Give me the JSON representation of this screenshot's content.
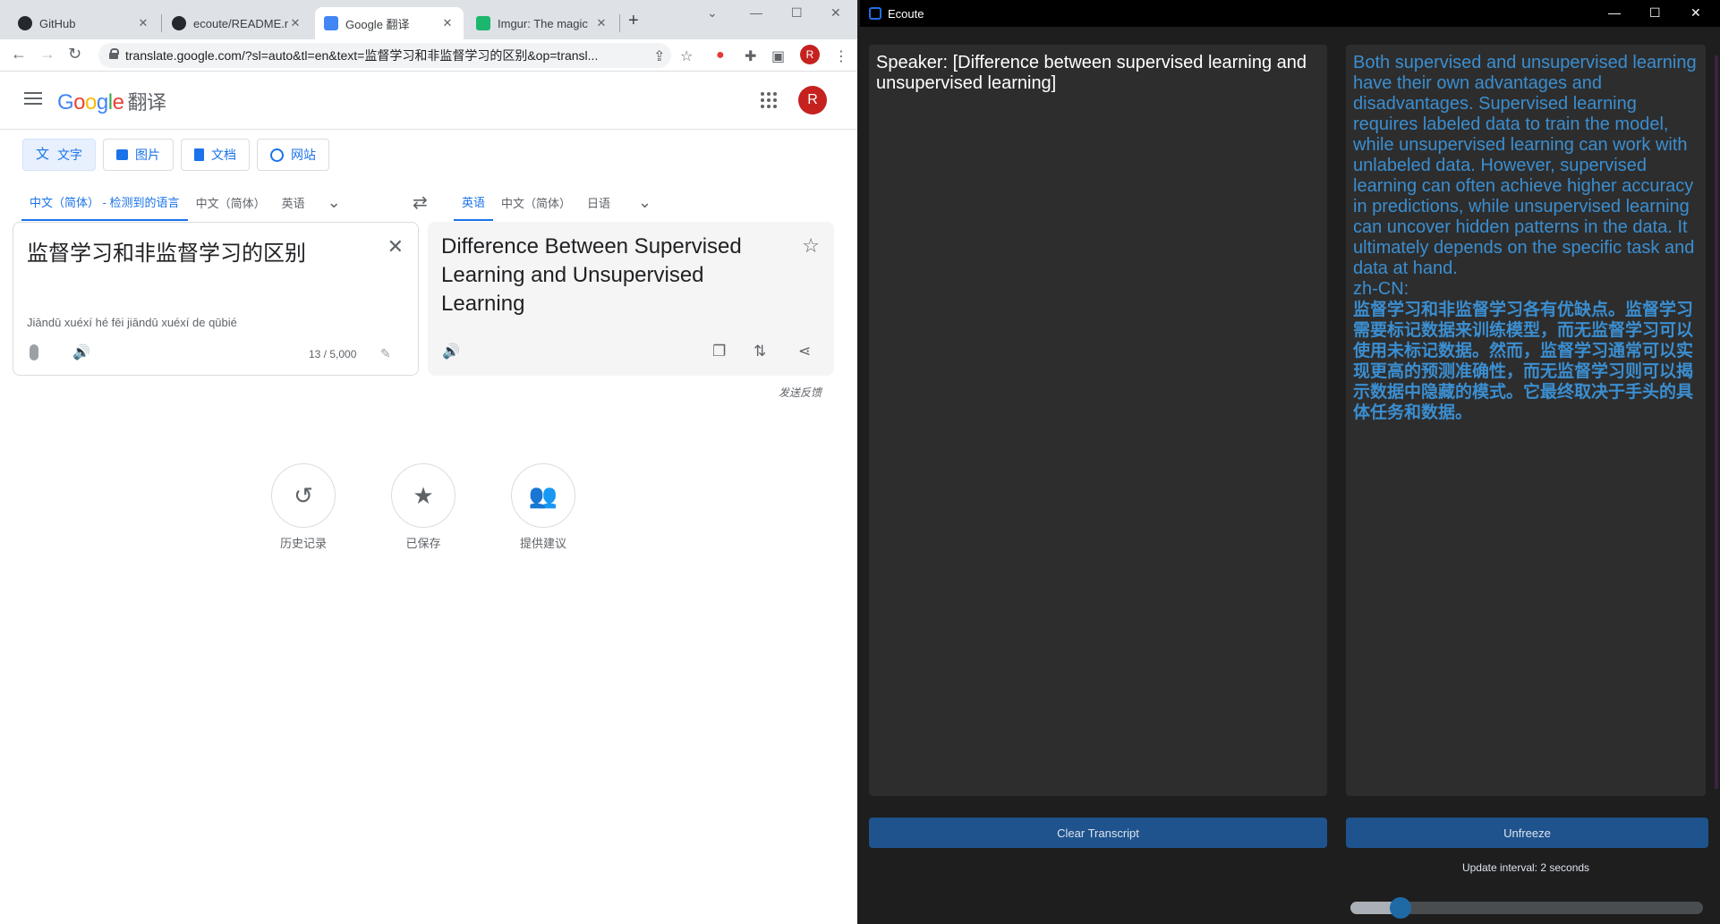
{
  "chrome": {
    "tabs": [
      {
        "title": "GitHub"
      },
      {
        "title": "ecoute/README.n"
      },
      {
        "title": "Google 翻译"
      },
      {
        "title": "Imgur: The magic"
      }
    ],
    "address": "translate.google.com/?sl=auto&tl=en&text=监督学习和非监督学习的区别&op=transl...",
    "profile_initial": "R"
  },
  "translate": {
    "logo_google": "Google",
    "logo_product": "翻译",
    "modes": [
      "文字",
      "图片",
      "文档",
      "网站"
    ],
    "source_langs": [
      "中文（简体） - 检测到的语言",
      "中文（简体）",
      "英语"
    ],
    "target_langs": [
      "英语",
      "中文（简体）",
      "日语"
    ],
    "source_text": "监督学习和非监督学习的区别",
    "pinyin": "Jiāndū xuéxí hé fēi jiāndū xuéxí de qūbié",
    "char_count": "13 / 5,000",
    "translation": "Difference Between Supervised Learning and Unsupervised Learning",
    "feedback": "发送反馈",
    "actions": [
      "历史记录",
      "已保存",
      "提供建议"
    ]
  },
  "ecoute": {
    "title": "Ecoute",
    "transcript": "Speaker: [Difference between supervised learning and unsupervised learning]",
    "response_en": "Both supervised and unsupervised learning have their own advantages and disadvantages. Supervised learning requires labeled data to train the model, while unsupervised learning can work with unlabeled data. However, supervised learning can often achieve higher accuracy in predictions, while unsupervised learning can uncover hidden patterns in the data. It ultimately depends on the specific task and data at hand.",
    "response_lang_label": "zh-CN:",
    "response_zh": "监督学习和非监督学习各有优缺点。监督学习需要标记数据来训练模型，而无监督学习可以使用未标记数据。然而，监督学习通常可以实现更高的预测准确性，而无监督学习则可以揭示数据中隐藏的模式。它最终取决于手头的具体任务和数据。",
    "clear_button": "Clear Transcript",
    "freeze_button": "Unfreeze",
    "interval_label": "Update interval: 2 seconds",
    "slider_fraction": 0.12
  },
  "colors": {
    "accent_blue": "#1a73e8",
    "ecoute_text_blue": "#3b8ed0",
    "ecoute_button": "#1f538d"
  }
}
